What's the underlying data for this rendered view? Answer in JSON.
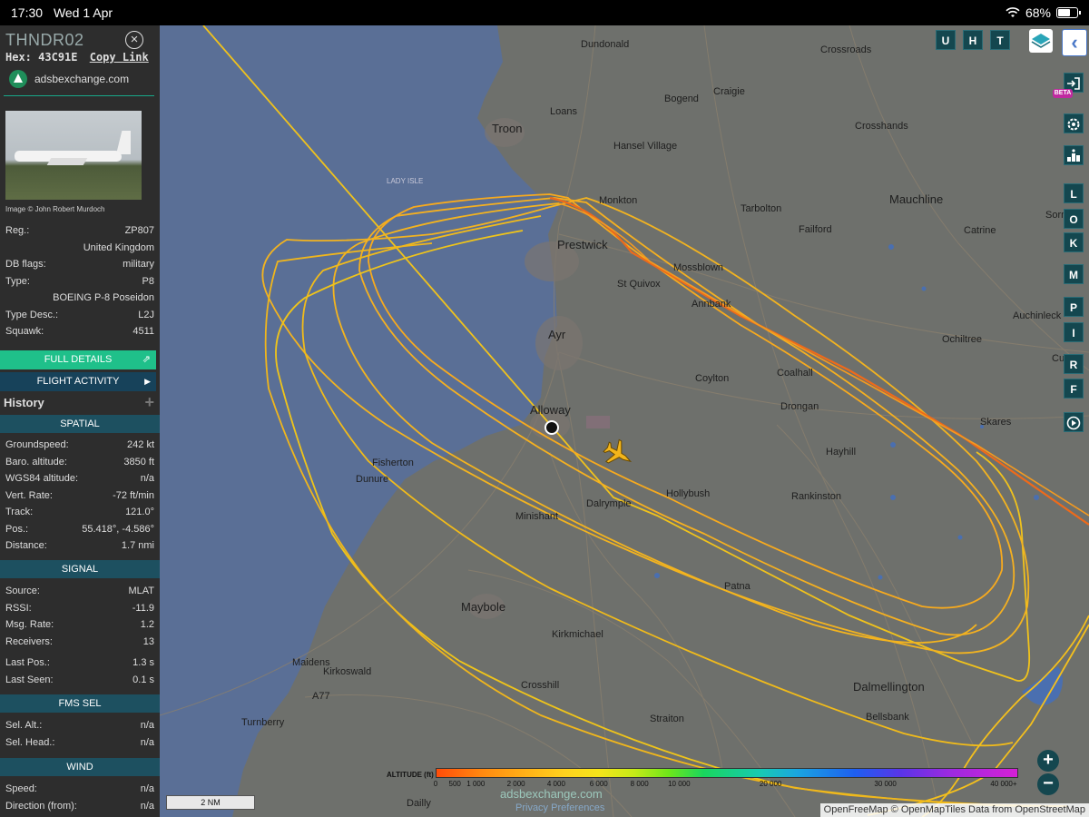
{
  "status_bar": {
    "time": "17:30",
    "date": "Wed 1 Apr",
    "battery": "68%",
    "battery_level": 0.68
  },
  "sidebar": {
    "callsign": "THNDR02",
    "close_symbol": "×",
    "hex_label": "Hex:",
    "hex_value": "43C91E",
    "copy_link": "Copy Link",
    "source_site": "adsbexchange.com",
    "photo_credit": "Image © John Robert Murdoch",
    "info": [
      {
        "key": "Reg.:",
        "value": "ZP807"
      },
      {
        "key": "",
        "value": "United Kingdom"
      },
      {
        "key": "DB flags:",
        "value": "military"
      },
      {
        "key": "Type:",
        "value": "P8"
      },
      {
        "key": "",
        "value": "BOEING P-8 Poseidon"
      },
      {
        "key": "Type Desc.:",
        "value": "L2J"
      },
      {
        "key": "Squawk:",
        "value": "4511"
      }
    ],
    "full_details": "FULL DETAILS",
    "flight_activity": "FLIGHT ACTIVITY",
    "history": "History",
    "sections": {
      "spatial": "SPATIAL",
      "signal": "SIGNAL",
      "fms_sel": "FMS SEL",
      "wind": "WIND"
    },
    "spatial": [
      {
        "key": "Groundspeed:",
        "value": "242 kt"
      },
      {
        "key": "Baro. altitude:",
        "value": "3850 ft"
      },
      {
        "key": "WGS84 altitude:",
        "value": "n/a"
      },
      {
        "key": "Vert. Rate:",
        "value": "-72 ft/min"
      },
      {
        "key": "Track:",
        "value": "121.0°"
      },
      {
        "key": "Pos.:",
        "value": "55.418°, -4.586°"
      },
      {
        "key": "Distance:",
        "value": "1.7 nmi"
      }
    ],
    "signal": [
      {
        "key": "Source:",
        "value": "MLAT"
      },
      {
        "key": "RSSI:",
        "value": "-11.9"
      },
      {
        "key": "Msg. Rate:",
        "value": "1.2"
      },
      {
        "key": "Receivers:",
        "value": "13"
      },
      {
        "key": "Last Pos.:",
        "value": "1.3 s"
      },
      {
        "key": "Last Seen:",
        "value": "0.1 s"
      }
    ],
    "fms": [
      {
        "key": "Sel. Alt.:",
        "value": "n/a"
      },
      {
        "key": "Sel. Head.:",
        "value": "n/a"
      }
    ],
    "wind": [
      {
        "key": "Speed:",
        "value": "n/a"
      },
      {
        "key": "Direction (from):",
        "value": "n/a"
      }
    ]
  },
  "map": {
    "top_buttons": [
      "U",
      "H",
      "T"
    ],
    "side_buttons": [
      "L",
      "O",
      "K",
      "M",
      "P",
      "I",
      "R",
      "F"
    ],
    "beta": "BETA",
    "zoom_in": "+",
    "zoom_out": "−",
    "scale": "2 NM",
    "watermark": "adsbexchange.com",
    "watermark_sub": "Privacy Preferences",
    "attribution": "OpenFreeMap © OpenMapTiles Data from OpenStreetMap",
    "road_label": "A77",
    "sea_label": "LADY ISLE",
    "towns": [
      {
        "name": "Dundonald"
      },
      {
        "name": "Crossroads"
      },
      {
        "name": "Craigie"
      },
      {
        "name": "Bogend"
      },
      {
        "name": "Loans"
      },
      {
        "name": "Troon",
        "big": true
      },
      {
        "name": "Hansel Village"
      },
      {
        "name": "Crosshands"
      },
      {
        "name": "Monkton"
      },
      {
        "name": "Tarbolton"
      },
      {
        "name": "Mauchline",
        "big": true
      },
      {
        "name": "Sorn"
      },
      {
        "name": "Failford"
      },
      {
        "name": "Catrine"
      },
      {
        "name": "Prestwick",
        "big": true
      },
      {
        "name": "Mossblown"
      },
      {
        "name": "St Quivox"
      },
      {
        "name": "Annbank"
      },
      {
        "name": "Auchinleck"
      },
      {
        "name": "Ayr",
        "big": true
      },
      {
        "name": "Ochiltree"
      },
      {
        "name": "Coylton"
      },
      {
        "name": "Coalhall"
      },
      {
        "name": "Cu"
      },
      {
        "name": "Alloway",
        "big": true
      },
      {
        "name": "Drongan"
      },
      {
        "name": "Skares"
      },
      {
        "name": "Hayhill"
      },
      {
        "name": "Fisherton"
      },
      {
        "name": "Dunure"
      },
      {
        "name": "Hollybush"
      },
      {
        "name": "Dalrymple"
      },
      {
        "name": "Rankinston"
      },
      {
        "name": "Minishant"
      },
      {
        "name": "Patna"
      },
      {
        "name": "Maybole",
        "big": true
      },
      {
        "name": "Kirkmichael"
      },
      {
        "name": "Maidens"
      },
      {
        "name": "Kirkoswald"
      },
      {
        "name": "Dalmellington",
        "big": true
      },
      {
        "name": "Crosshill"
      },
      {
        "name": "Bellsbank"
      },
      {
        "name": "Turnberry"
      },
      {
        "name": "Straiton"
      },
      {
        "name": "Dailly"
      }
    ]
  },
  "legend": {
    "title": "ALTITUDE (ft)",
    "ticks": [
      "0",
      "500",
      "1 000",
      "2 000",
      "4 000",
      "6 000",
      "8 000",
      "10 000",
      "20 000",
      "30 000",
      "40 000+"
    ]
  },
  "colors": {
    "track_low": "#e8bc1c",
    "track_mid": "#f5a623",
    "track_high": "#f05a1a",
    "sea": "#5a6f96",
    "land": "#6f716d",
    "panel": "#2d2d2d",
    "accent": "#1fc08a",
    "section": "#1d5060"
  }
}
